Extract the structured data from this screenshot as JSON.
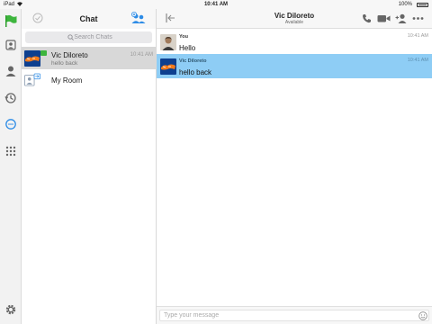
{
  "status_bar": {
    "device": "iPad",
    "time": "10:41 AM",
    "battery": "100%"
  },
  "colors": {
    "accent": "#2d8ce6",
    "selected_row": "#d8d8d8",
    "highlight_message": "#8ecdf5",
    "brand_green": "#2a9d2a"
  },
  "rail": {
    "icons": [
      "flag-icon",
      "contacts-card-icon",
      "profile-icon",
      "history-icon",
      "chat-bubble-icon",
      "dialpad-icon",
      "settings-icon"
    ],
    "active": "chat-bubble-icon"
  },
  "chat_list": {
    "title": "Chat",
    "search_placeholder": "Search Chats",
    "items": [
      {
        "name": "Vic Diloreto",
        "preview": "hello back",
        "time": "10:41 AM",
        "selected": true,
        "avatar": "gators-logo-avatar"
      },
      {
        "name": "My Room",
        "preview": "",
        "time": "",
        "selected": false,
        "avatar": "room-icon"
      }
    ]
  },
  "conversation": {
    "contact_name": "Vic Diloreto",
    "presence": "Available",
    "messages": [
      {
        "sender": "You",
        "text": "Hello",
        "time": "10:41 AM",
        "highlighted": false,
        "avatar": "user-photo-avatar"
      },
      {
        "sender": "Vic Diloreto",
        "text": "hello back",
        "time": "10:41 AM",
        "highlighted": true,
        "avatar": "gators-logo-avatar"
      }
    ],
    "composer_placeholder": "Type your message"
  }
}
